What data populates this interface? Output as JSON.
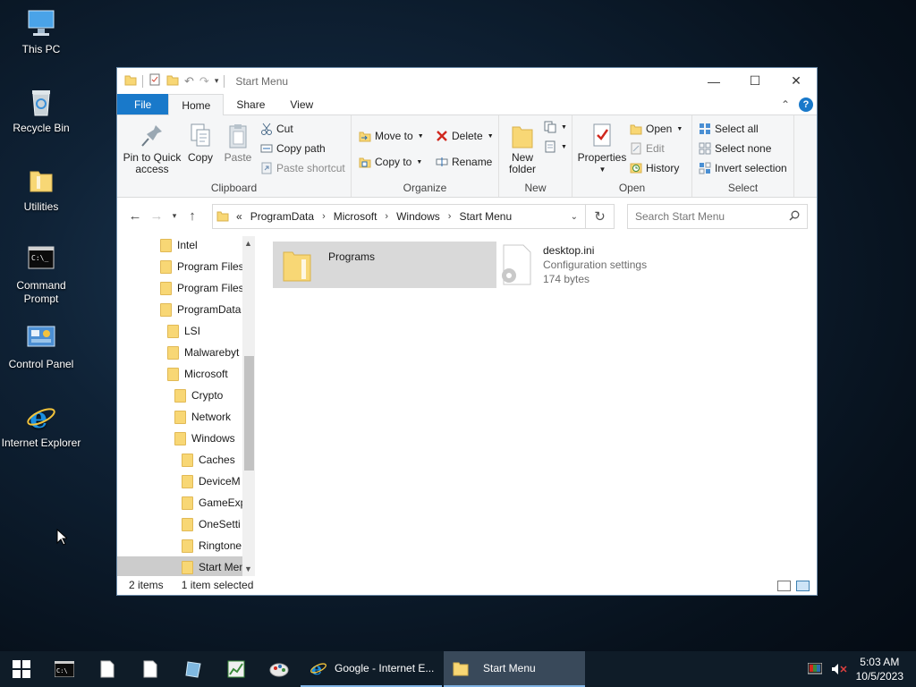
{
  "desktop": {
    "icons": [
      {
        "label": "This PC",
        "icon": "this-pc-icon"
      },
      {
        "label": "Recycle Bin",
        "icon": "recycle-bin-icon"
      },
      {
        "label": "Utilities",
        "icon": "folder-icon"
      },
      {
        "label": "Command Prompt",
        "icon": "cmd-icon"
      },
      {
        "label": "Control Panel",
        "icon": "control-panel-icon"
      },
      {
        "label": "Internet Explorer",
        "icon": "ie-icon"
      }
    ]
  },
  "window": {
    "title": "Start Menu",
    "controls": {
      "minimize": "—",
      "maximize": "☐",
      "close": "✕"
    }
  },
  "ribbon": {
    "tabs": [
      {
        "label": "File"
      },
      {
        "label": "Home"
      },
      {
        "label": "Share"
      },
      {
        "label": "View"
      }
    ],
    "groups": {
      "clipboard": {
        "name": "Clipboard",
        "pin": "Pin to Quick access",
        "pin_l1": "Pin to Quick",
        "pin_l2": "access",
        "copy": "Copy",
        "paste": "Paste",
        "cut": "Cut",
        "copy_path": "Copy path",
        "paste_shortcut": "Paste shortcut"
      },
      "organize": {
        "name": "Organize",
        "move_to": "Move to",
        "copy_to": "Copy to",
        "delete": "Delete",
        "rename": "Rename"
      },
      "new": {
        "name": "New",
        "new_folder_l1": "New",
        "new_folder_l2": "folder"
      },
      "open": {
        "name": "Open",
        "properties": "Properties",
        "open": "Open",
        "edit": "Edit",
        "history": "History"
      },
      "select": {
        "name": "Select",
        "select_all": "Select all",
        "select_none": "Select none",
        "invert": "Invert selection"
      }
    }
  },
  "address": {
    "overflow": "«",
    "crumbs": [
      "ProgramData",
      "Microsoft",
      "Windows",
      "Start Menu"
    ],
    "search_placeholder": "Search Start Menu"
  },
  "nav_tree": [
    {
      "label": "Intel",
      "level": 0
    },
    {
      "label": "Program Files",
      "level": 0
    },
    {
      "label": "Program Files",
      "level": 0
    },
    {
      "label": "ProgramData",
      "level": 0
    },
    {
      "label": "LSI",
      "level": 1
    },
    {
      "label": "Malwarebyt",
      "level": 1
    },
    {
      "label": "Microsoft",
      "level": 1
    },
    {
      "label": "Crypto",
      "level": 2
    },
    {
      "label": "Network",
      "level": 2
    },
    {
      "label": "Windows",
      "level": 2
    },
    {
      "label": "Caches",
      "level": 3
    },
    {
      "label": "DeviceM",
      "level": 3
    },
    {
      "label": "GameExp",
      "level": 3
    },
    {
      "label": "OneSetti",
      "level": 3
    },
    {
      "label": "Ringtone",
      "level": 3
    },
    {
      "label": "Start Men",
      "level": 3,
      "selected": true
    }
  ],
  "files": [
    {
      "name": "Programs",
      "type": "folder",
      "selected": true
    },
    {
      "name": "desktop.ini",
      "desc": "Configuration settings",
      "size": "174 bytes",
      "type": "settings-file"
    }
  ],
  "status": {
    "count": "2 items",
    "selection": "1 item selected"
  },
  "taskbar": {
    "apps": [
      {
        "label": "Google - Internet E...",
        "icon": "ie-icon"
      },
      {
        "label": "Start Menu",
        "icon": "folder-icon",
        "active": true
      }
    ],
    "time": "5:03 AM",
    "date": "10/5/2023"
  },
  "colors": {
    "accent": "#1979ca",
    "folder": "#f8d775",
    "selection": "#d9d9d9",
    "taskbar": "#0f1c28"
  }
}
